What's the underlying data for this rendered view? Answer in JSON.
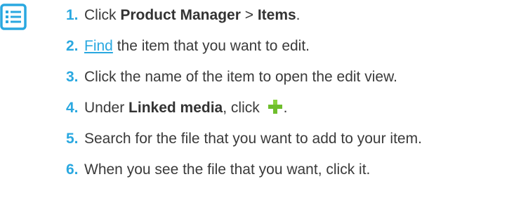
{
  "icons": {
    "list": "list-icon",
    "add": "plus-icon",
    "list_color": "#2aa8e0",
    "add_color": "#6fbe2c"
  },
  "steps": [
    {
      "num": "1.",
      "pre": "Click ",
      "b1": "Product Manager",
      "mid": " > ",
      "b2": "Items",
      "post": "."
    },
    {
      "num": "2.",
      "link": "Find",
      "post": " the item that you want to edit."
    },
    {
      "num": "3.",
      "text": "Click the name of the item to open the edit view."
    },
    {
      "num": "4.",
      "pre": "Under ",
      "b1": "Linked media",
      "mid": ", click ",
      "post": "."
    },
    {
      "num": "5.",
      "text": "Search for the file that you want to add to your item."
    },
    {
      "num": "6.",
      "text": "When you see the file that you want, click it."
    }
  ]
}
